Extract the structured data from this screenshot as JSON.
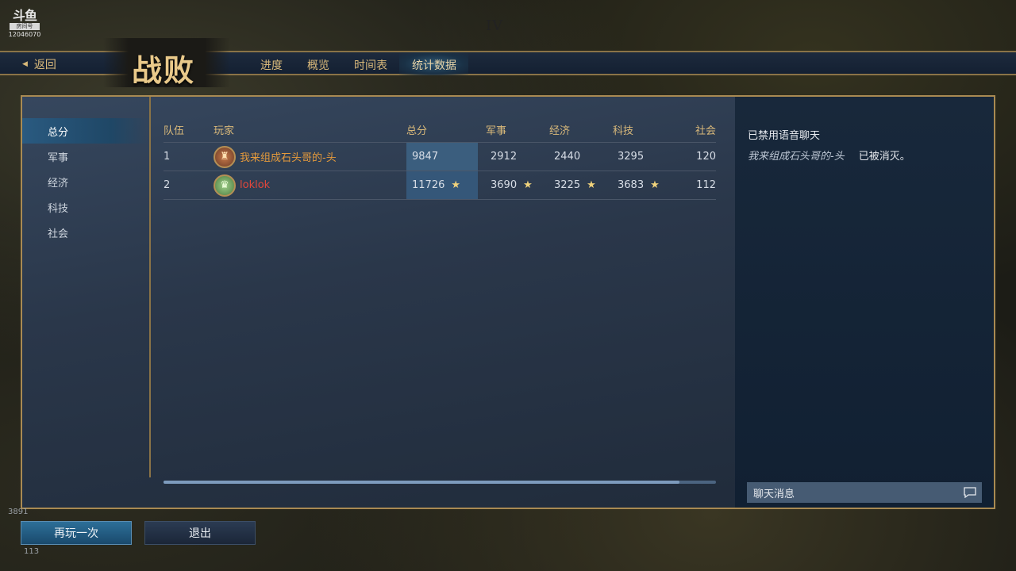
{
  "watermark": {
    "logo": "斗鱼",
    "tag": "房间号",
    "room_id": "12046070"
  },
  "era_mark": "IV",
  "nav": {
    "back_label": "返回",
    "title": "战败",
    "tabs": [
      {
        "label": "进度"
      },
      {
        "label": "概览"
      },
      {
        "label": "时间表"
      },
      {
        "label": "统计数据"
      }
    ],
    "active_tab": 3
  },
  "sidebar": {
    "items": [
      {
        "label": "总分"
      },
      {
        "label": "军事"
      },
      {
        "label": "经济"
      },
      {
        "label": "科技"
      },
      {
        "label": "社会"
      }
    ],
    "active_index": 0
  },
  "table": {
    "headers": {
      "team": "队伍",
      "player": "玩家",
      "total": "总分",
      "military": "军事",
      "economy": "经济",
      "technology": "科技",
      "society": "社会"
    },
    "rows": [
      {
        "team": "1",
        "player": "我来组成石头哥的-头",
        "total": "9847",
        "military": "2912",
        "economy": "2440",
        "technology": "3295",
        "society": "120",
        "stars": {
          "total": false,
          "military": false,
          "economy": false,
          "technology": false
        }
      },
      {
        "team": "2",
        "player": "loklok",
        "total": "11726",
        "military": "3690",
        "economy": "3225",
        "technology": "3683",
        "society": "112",
        "stars": {
          "total": true,
          "military": true,
          "economy": true,
          "technology": true
        }
      }
    ],
    "star_glyph": "★"
  },
  "chat": {
    "voice_status": "已禁用语音聊天",
    "event_player": "我来组成石头哥的-头",
    "event_text": "已被消灭。",
    "input_placeholder": "聊天消息"
  },
  "buttons": {
    "replay": "再玩一次",
    "quit": "退出"
  },
  "bottom_left": {
    "resource_1": "3891",
    "resource_2": "113"
  },
  "colors": {
    "gold": "#d9b97a",
    "panel_border": "#a98a52",
    "highlight": "#3b5e7e",
    "player1": "#e59a3c",
    "player2": "#e2473b"
  }
}
